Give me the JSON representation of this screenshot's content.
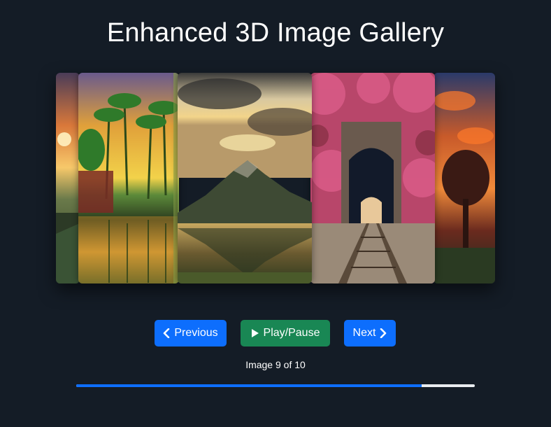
{
  "title": "Enhanced 3D Image Gallery",
  "gallery": {
    "slides": [
      {
        "name": "sunset-fire-sky"
      },
      {
        "name": "palm-trees-lake"
      },
      {
        "name": "mountain-lake-reflection"
      },
      {
        "name": "railway-tunnel-pink-trees"
      },
      {
        "name": "fiery-tree-sky"
      }
    ]
  },
  "controls": {
    "previous_label": "Previous",
    "play_pause_label": "Play/Pause",
    "next_label": "Next",
    "previous_icon": "chevron-left-icon",
    "play_icon": "play-icon",
    "next_icon": "chevron-right-icon"
  },
  "status": {
    "counter_text": "Image 9 of 10",
    "current": 9,
    "total": 10
  },
  "progress": {
    "fraction": 0.867
  },
  "colors": {
    "background": "#141c26",
    "primary": "#0d6efd",
    "success": "#198754",
    "track": "#e9ecef"
  }
}
